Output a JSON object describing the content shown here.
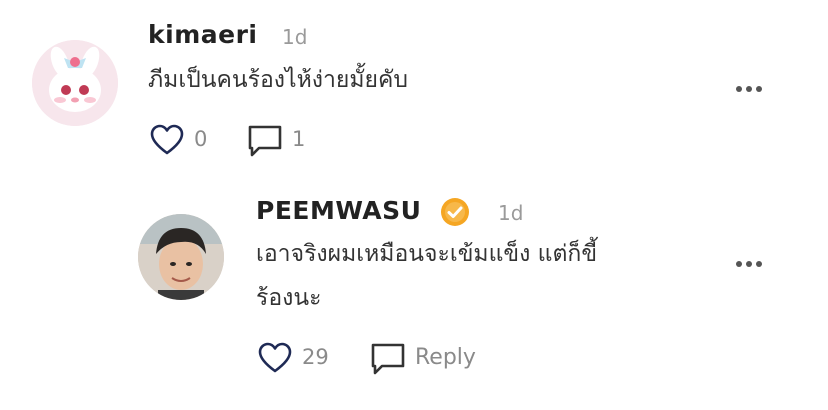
{
  "comment": {
    "username": "kimaeri",
    "time": "1d",
    "text": "ภีมเป็นคนร้องไห้ง่ายมั้ยคับ",
    "like_count": "0",
    "reply_count": "1",
    "avatar_icon": "pink-bunny-avatar"
  },
  "reply": {
    "username": "PEEMWASU",
    "time": "1d",
    "text_line1": "เอาจริงผมเหมือนจะเข้มแข็ง แต่ก็ขี้",
    "text_line2": "ร้องนะ",
    "like_count": "29",
    "reply_label": "Reply",
    "verified_icon": "verified-badge-icon",
    "verified_color": "#F5A623"
  }
}
